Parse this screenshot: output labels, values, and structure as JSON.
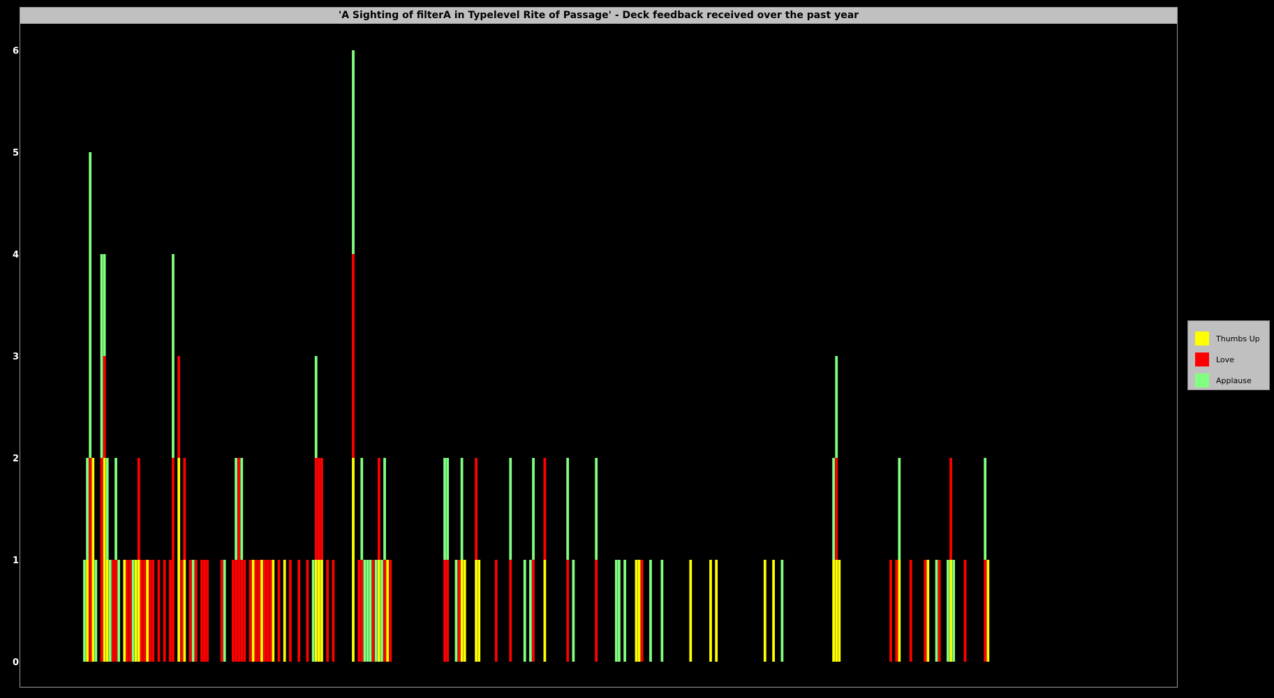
{
  "chart_data": {
    "type": "bar",
    "stacked": true,
    "title": "'A Sighting of filterA in Typelevel Rite of Passage' - Deck feedback received over the past year",
    "xlabel": "",
    "ylabel": "",
    "ylim": [
      0,
      6
    ],
    "y_ticks": [
      "0",
      "1",
      "2",
      "3",
      "4",
      "5",
      "6"
    ],
    "x_ticks": [],
    "grid": false,
    "legend_position": "right",
    "num_bins": 365,
    "colors": {
      "Thumbs Up": "#ffff00",
      "Love": "#ff0000",
      "Applause": "#80ff80"
    },
    "series": [
      {
        "name": "Thumbs Up",
        "points": [
          [
            2,
            1
          ],
          [
            4,
            2
          ],
          [
            8,
            2
          ],
          [
            9,
            1
          ],
          [
            15,
            1
          ],
          [
            19,
            1
          ],
          [
            20,
            1
          ],
          [
            23,
            1
          ],
          [
            34,
            2
          ],
          [
            36,
            1
          ],
          [
            60,
            1
          ],
          [
            63,
            1
          ],
          [
            67,
            1
          ],
          [
            71,
            1
          ],
          [
            82,
            1
          ],
          [
            83,
            1
          ],
          [
            84,
            1
          ],
          [
            95,
            2
          ],
          [
            104,
            1
          ],
          [
            107,
            1
          ],
          [
            133,
            1
          ],
          [
            134,
            1
          ],
          [
            138,
            1
          ],
          [
            139,
            1
          ],
          [
            162,
            1
          ],
          [
            194,
            1
          ],
          [
            195,
            1
          ],
          [
            213,
            1
          ],
          [
            220,
            1
          ],
          [
            222,
            1
          ],
          [
            239,
            1
          ],
          [
            242,
            1
          ],
          [
            263,
            1
          ],
          [
            264,
            1
          ],
          [
            265,
            1
          ],
          [
            286,
            1
          ],
          [
            296,
            1
          ],
          [
            304,
            1
          ],
          [
            317,
            1
          ]
        ]
      },
      {
        "name": "Love",
        "points": [
          [
            3,
            2
          ],
          [
            7,
            2
          ],
          [
            8,
            1
          ],
          [
            11,
            1
          ],
          [
            12,
            1
          ],
          [
            16,
            1
          ],
          [
            17,
            1
          ],
          [
            20,
            1
          ],
          [
            21,
            1
          ],
          [
            22,
            1
          ],
          [
            24,
            1
          ],
          [
            25,
            1
          ],
          [
            27,
            1
          ],
          [
            29,
            1
          ],
          [
            31,
            1
          ],
          [
            32,
            2
          ],
          [
            34,
            1
          ],
          [
            35,
            1
          ],
          [
            36,
            1
          ],
          [
            38,
            1
          ],
          [
            40,
            1
          ],
          [
            42,
            1
          ],
          [
            43,
            1
          ],
          [
            44,
            1
          ],
          [
            49,
            1
          ],
          [
            53,
            1
          ],
          [
            54,
            1
          ],
          [
            55,
            2
          ],
          [
            56,
            1
          ],
          [
            57,
            1
          ],
          [
            59,
            1
          ],
          [
            61,
            1
          ],
          [
            62,
            1
          ],
          [
            64,
            1
          ],
          [
            65,
            1
          ],
          [
            66,
            1
          ],
          [
            69,
            1
          ],
          [
            73,
            1
          ],
          [
            76,
            1
          ],
          [
            79,
            1
          ],
          [
            82,
            1
          ],
          [
            83,
            1
          ],
          [
            84,
            1
          ],
          [
            86,
            1
          ],
          [
            88,
            1
          ],
          [
            95,
            2
          ],
          [
            97,
            1
          ],
          [
            98,
            1
          ],
          [
            102,
            1
          ],
          [
            104,
            1
          ],
          [
            106,
            1
          ],
          [
            108,
            1
          ],
          [
            127,
            1
          ],
          [
            128,
            1
          ],
          [
            132,
            1
          ],
          [
            138,
            1
          ],
          [
            145,
            1
          ],
          [
            150,
            1
          ],
          [
            158,
            1
          ],
          [
            162,
            1
          ],
          [
            170,
            1
          ],
          [
            180,
            1
          ],
          [
            196,
            1
          ],
          [
            264,
            1
          ],
          [
            283,
            1
          ],
          [
            285,
            1
          ],
          [
            290,
            1
          ],
          [
            295,
            1
          ],
          [
            300,
            1
          ],
          [
            304,
            1
          ],
          [
            309,
            1
          ],
          [
            316,
            1
          ]
        ]
      },
      {
        "name": "Applause",
        "points": [
          [
            1,
            1
          ],
          [
            2,
            1
          ],
          [
            3,
            3
          ],
          [
            5,
            1
          ],
          [
            7,
            2
          ],
          [
            8,
            1
          ],
          [
            9,
            1
          ],
          [
            10,
            1
          ],
          [
            12,
            1
          ],
          [
            13,
            1
          ],
          [
            18,
            1
          ],
          [
            32,
            2
          ],
          [
            39,
            1
          ],
          [
            50,
            1
          ],
          [
            54,
            1
          ],
          [
            56,
            1
          ],
          [
            81,
            1
          ],
          [
            82,
            1
          ],
          [
            95,
            2
          ],
          [
            98,
            1
          ],
          [
            99,
            1
          ],
          [
            100,
            1
          ],
          [
            101,
            1
          ],
          [
            103,
            1
          ],
          [
            105,
            1
          ],
          [
            106,
            1
          ],
          [
            127,
            1
          ],
          [
            128,
            1
          ],
          [
            131,
            1
          ],
          [
            133,
            1
          ],
          [
            150,
            1
          ],
          [
            155,
            1
          ],
          [
            157,
            1
          ],
          [
            158,
            1
          ],
          [
            170,
            1
          ],
          [
            172,
            1
          ],
          [
            180,
            1
          ],
          [
            187,
            1
          ],
          [
            188,
            1
          ],
          [
            190,
            1
          ],
          [
            199,
            1
          ],
          [
            203,
            1
          ],
          [
            245,
            1
          ],
          [
            263,
            1
          ],
          [
            264,
            1
          ],
          [
            286,
            1
          ],
          [
            299,
            1
          ],
          [
            303,
            1
          ],
          [
            305,
            1
          ],
          [
            316,
            1
          ]
        ]
      }
    ]
  }
}
